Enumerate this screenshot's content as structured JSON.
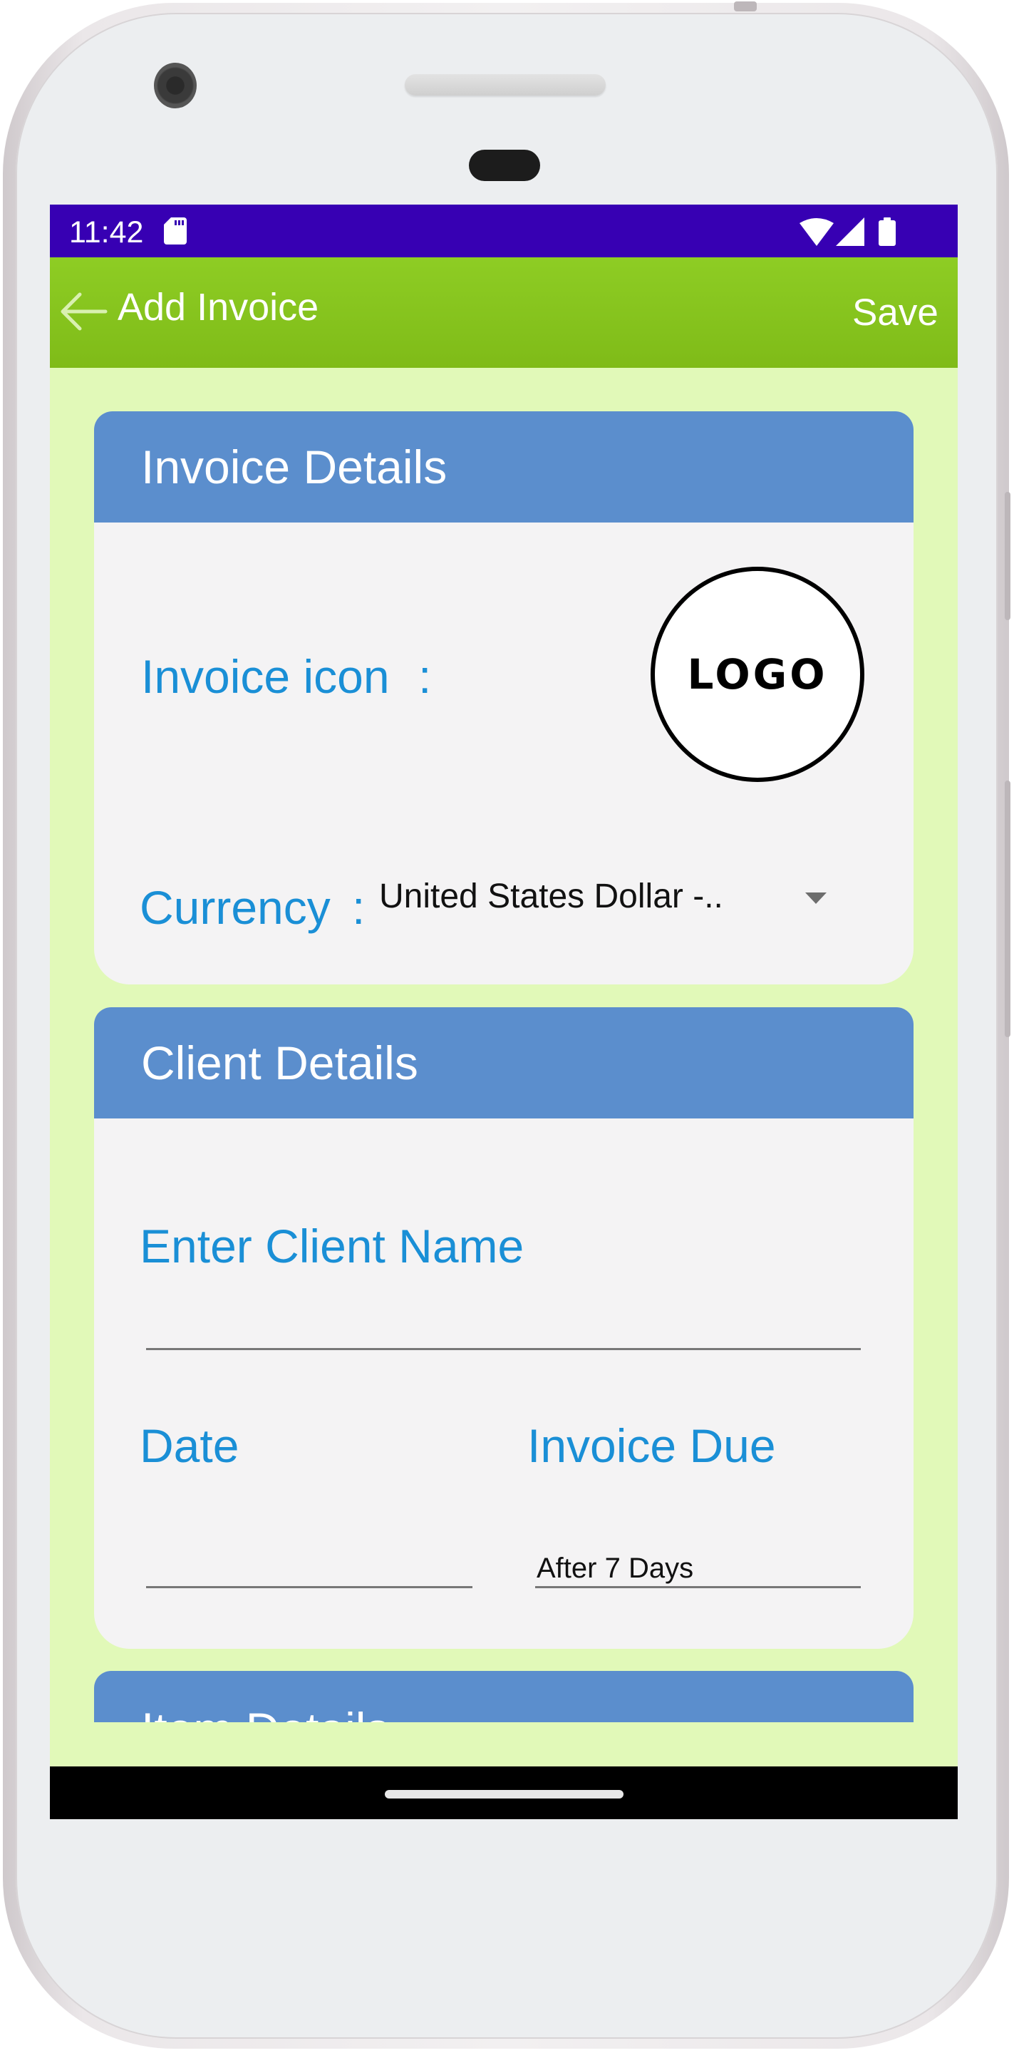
{
  "status_bar": {
    "time": "11:42",
    "icons": [
      "sd-card-icon",
      "wifi-icon",
      "cellular-signal-icon",
      "battery-icon"
    ]
  },
  "app_bar": {
    "back_icon": "arrow-left-icon",
    "title": "Add Invoice",
    "save_label": "Save"
  },
  "invoice_details": {
    "header": "Invoice Details",
    "icon_label": "Invoice icon",
    "icon_separator": ":",
    "logo_text": "LOGO",
    "currency_label": "Currency",
    "currency_separator": ":",
    "currency_value": "United States Dollar -..",
    "currency_dropdown_icon": "caret-down-icon"
  },
  "client_details": {
    "header": "Client Details",
    "client_name_label": "Enter Client Name",
    "client_name_value": "",
    "date_label": "Date",
    "date_value": "",
    "invoice_due_label": "Invoice Due",
    "invoice_due_value": "After 7 Days"
  },
  "item_details": {
    "header": "Item Details"
  },
  "colors": {
    "status_bar": "#3700b3",
    "app_bar": "#8ecd24",
    "background": "#e1f9b8",
    "card_header": "#5b8ecd",
    "card_body": "#f4f3f4",
    "label": "#1a8fd6"
  }
}
